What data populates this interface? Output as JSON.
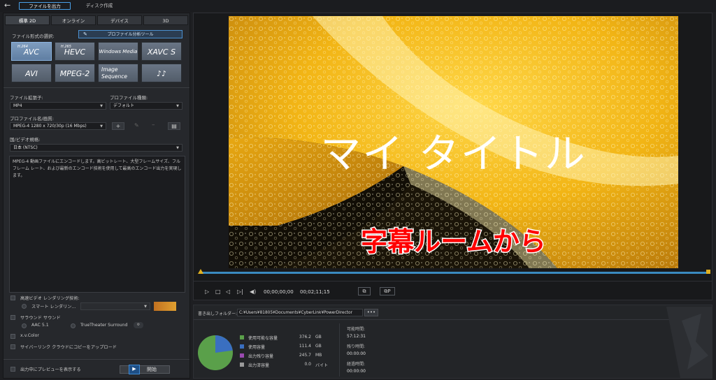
{
  "topbar": {
    "tab_output": "ファイルを出力",
    "tab_disc": "ディスク作成"
  },
  "left": {
    "tabs": [
      "標準 2D",
      "オンライン",
      "デバイス",
      "3D"
    ],
    "format_label": "ファイル形式の選択:",
    "profile_tool": "プロファイル分析ツール",
    "formats": [
      {
        "main": "AVC",
        "sup": "H.264"
      },
      {
        "main": "HEVC",
        "sup": "H.265"
      },
      {
        "main": "Windows Media",
        "sup": ""
      },
      {
        "main": "XAVC S",
        "sup": ""
      },
      {
        "main": "AVI",
        "sup": ""
      },
      {
        "main": "MPEG-2",
        "sup": ""
      },
      {
        "main": "Image Sequence",
        "sup": ""
      },
      {
        "main": "♪♪",
        "sup": ""
      }
    ],
    "ext_label": "ファイル拡張子:",
    "ext_value": "MP4",
    "ptype_label": "プロファイル種類:",
    "ptype_value": "デフォルト",
    "pname_label": "プロファイル名/画質:",
    "pname_value": "MPEG-4 1280 x 720/30p (16 Mbps)",
    "region_label": "国/ビデオ規格:",
    "region_value": "日本 (NTSC)",
    "description": "MPEG-4 動画ファイルにエンコードします。高ビットレート、大型フレームサイズ、フル フレーム レート、および最新のエンコード技術を使用して最高のエンコード出力を実現します。",
    "accel_label": "高速ビデオ レンダリング技術:",
    "smart_label": "スマート レンダリン...",
    "surround_label": "サラウンド サウンド",
    "aac_label": "AAC 5.1",
    "truetheater_label": "TrueTheater Surround",
    "xvcolor_label": "x.v.Color",
    "upload_label": "サイバーリンク クラウドにコピーをアップロード",
    "preview_label": "出力中にプレビューを表示する",
    "start_label": "開始"
  },
  "preview": {
    "title_text": "マイ タイトル",
    "subtitle_text": "字幕ルームから",
    "time_current": "00;00;00;00",
    "time_total": "00;02;11;15"
  },
  "output": {
    "folder_label": "書き出しフォルダー:",
    "folder_value": "C:¥Users¥81805¥Documents¥CyberLink¥PowerDirector",
    "browse_label": "•••",
    "legend": [
      {
        "label": "使用可能な容量",
        "value": "376.2",
        "unit": "GB",
        "color": "#5aa04a"
      },
      {
        "label": "使用容量",
        "value": "111.4",
        "unit": "GB",
        "color": "#3a6fc0"
      },
      {
        "label": "出力残り容量",
        "value": "245.7",
        "unit": "MB",
        "color": "#9a4ab0"
      },
      {
        "label": "出力済容量",
        "value": "0.0",
        "unit": "バイト",
        "color": "#9a9a9a"
      }
    ],
    "pie": {
      "available": 376.2,
      "used": 111.4
    },
    "right": {
      "possible_label": "可能時間:",
      "possible_value": "57:12:31",
      "remain_label": "残り時間:",
      "remain_value": "00:00:00",
      "elapsed_label": "経過時間:",
      "elapsed_value": "00:00:00"
    }
  }
}
